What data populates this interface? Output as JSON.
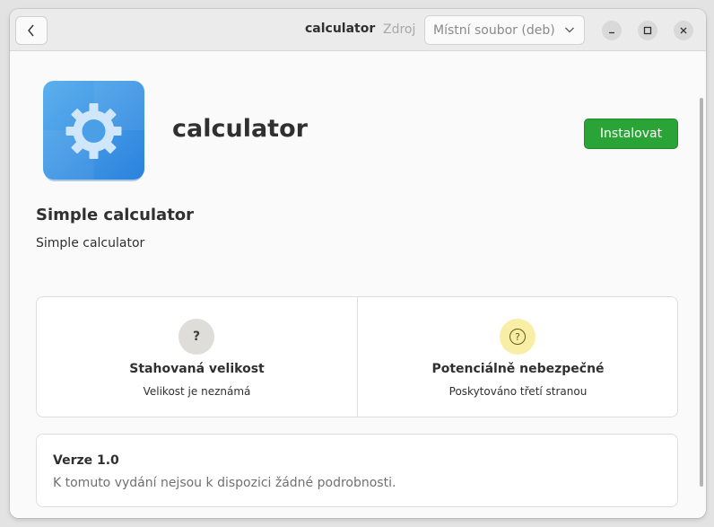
{
  "header": {
    "title": "calculator",
    "source_label": "Zdroj",
    "source_value": "Místní soubor (deb)",
    "back_icon": "chevron-left-icon",
    "minimize_icon": "minimize-icon",
    "maximize_icon": "maximize-icon",
    "close_icon": "close-icon"
  },
  "app": {
    "name": "calculator",
    "icon": "gear-icon",
    "install_label": "Instalovat",
    "summary": "Simple calculator",
    "description": "Simple calculator"
  },
  "info_tiles": [
    {
      "icon": "question-icon",
      "symbol": "?",
      "title": "Stahovaná velikost",
      "subtitle": "Velikost je neznámá",
      "color": "#deddda"
    },
    {
      "icon": "warning-question-icon",
      "symbol": "?",
      "title": "Potenciálně nebezpečné",
      "subtitle": "Poskytováno třetí stranou",
      "color": "#f9eea5"
    }
  ],
  "version": {
    "title": "Verze 1.0",
    "details": "K tomuto vydání nejsou k dispozici žádné podrobnosti."
  },
  "colors": {
    "accent_install": "#2aa337",
    "icon_blue": "#3e97e0"
  }
}
